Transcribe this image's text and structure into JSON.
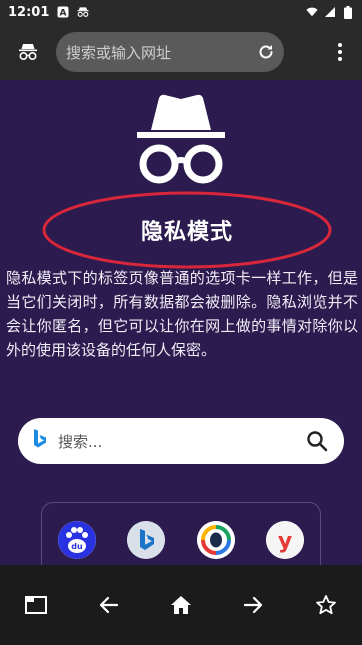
{
  "status_bar": {
    "time": "12:01"
  },
  "toolbar": {
    "url_placeholder": "搜索或输入网址"
  },
  "incognito": {
    "title": "隐私模式",
    "description": "隐私模式下的标签页像普通的选项卡一样工作，但是当它们关闭时，所有数据都会被删除。隐私浏览并不会让你匿名，但它可以让你在网上做的事情对除你以外的使用该设备的任何人保密。"
  },
  "search": {
    "placeholder": "搜索..."
  },
  "colors": {
    "background": "#2b1b4e",
    "toolbar": "#2a2a2a",
    "highlight_ring": "#d8263a",
    "bottom_bar": "#1b1b1b"
  },
  "shortcuts": [
    {
      "icon": "baidu-icon"
    },
    {
      "icon": "bing-icon"
    },
    {
      "icon": "tencent-qq-icon"
    },
    {
      "icon": "y-app-icon"
    }
  ],
  "bottom_nav": {
    "icons": [
      "tabs-icon",
      "back-arrow-icon",
      "home-icon",
      "forward-arrow-icon",
      "star-icon"
    ]
  }
}
